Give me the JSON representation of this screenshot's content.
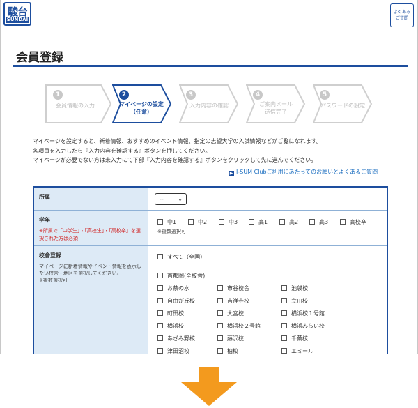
{
  "header": {
    "logo_main": "駿台",
    "logo_sub": "SUNDAI",
    "faq_line1": "よくある",
    "faq_line2": "ご質問"
  },
  "page": {
    "title": "会員登録"
  },
  "steps": [
    {
      "num": "1",
      "label": "会員情報の入力"
    },
    {
      "num": "2",
      "label": "マイページの設定",
      "label2": "（任意）"
    },
    {
      "num": "3",
      "label": "入力内容の確認"
    },
    {
      "num": "4",
      "label": "ご案内メール",
      "label2": "送信完了"
    },
    {
      "num": "5",
      "label": "パスワードの設定"
    }
  ],
  "intro": {
    "line1": "マイページを設定すると、新着情報、おすすめのイベント情報、指定の志望大学の入試情報などがご覧になれます。",
    "line2": "各項目を入力したら『入力内容を確認する』ボタンを押してください。",
    "line3": "マイページが必要でない方は未入力にて下部『入力内容を確認する』ボタンをクリックして先に進んでください。"
  },
  "help_link": {
    "icon": "▶",
    "text": "I-SUM Clubご利用にあたってのお願いとよくあるご質問"
  },
  "form": {
    "affiliation": {
      "label": "所属",
      "select_value": "--",
      "chevron": "⌄"
    },
    "grade": {
      "label": "学年",
      "note": "※所属で「中学生」・「高校生」・「高校卒」を選択された方は必須",
      "options": [
        "中1",
        "中2",
        "中3",
        "高1",
        "高2",
        "高3",
        "高校卒"
      ],
      "multi_note": "※複数選択可"
    },
    "campus": {
      "label": "校舎登録",
      "note": "マイページに新着情報やイベント情報を表示したい校舎・地区を選択してください。",
      "multi_note": "※複数選択可",
      "all_option": "すべて（全国）",
      "region": "首都圏(全校舎)",
      "schools": [
        "お茶の水",
        "市谷校舎",
        "池袋校",
        "自由が丘校",
        "吉祥寺校",
        "立川校",
        "町田校",
        "大宮校",
        "横浜校１号館",
        "横浜校",
        "横浜校２号館",
        "横浜みらい校",
        "あざみ野校",
        "藤沢校",
        "千葉校",
        "津田沼校",
        "柏校",
        "エミール"
      ]
    }
  },
  "colors": {
    "brand": "#1d4e9e",
    "arrow": "#f39a1e",
    "link": "#1d6fc0",
    "required_note": "#d01b1b"
  }
}
